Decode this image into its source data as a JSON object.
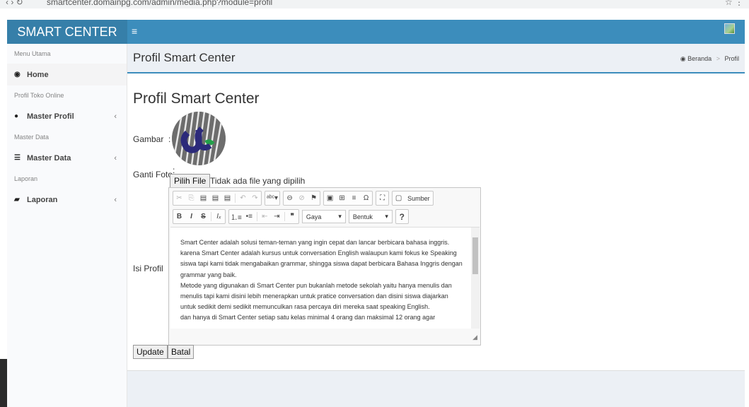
{
  "browser": {
    "nav": "‹ › ↻",
    "url": "smartcenter.domainpg.com/admin/media.php?module=profil",
    "right": "☆ ⋮"
  },
  "header": {
    "brand": "SMART CENTER",
    "menu_icon": "hamburger-icon"
  },
  "sidebar": {
    "sections": [
      {
        "header": "Menu Utama",
        "items": [
          {
            "label": "Home",
            "icon": "dashboard-icon"
          }
        ]
      },
      {
        "header": "Profil Toko Online",
        "items": [
          {
            "label": "Master Profil",
            "icon": "user-icon"
          }
        ]
      },
      {
        "header": "Master Data",
        "items": [
          {
            "label": "Master Data",
            "icon": "database-icon"
          }
        ]
      },
      {
        "header": "Laporan",
        "items": [
          {
            "label": "Laporan",
            "icon": "book-icon"
          }
        ]
      }
    ]
  },
  "content_header": {
    "title": "Profil Smart Center",
    "breadcrumb": [
      "Beranda",
      "Profil"
    ]
  },
  "form": {
    "heading": "Profil Smart Center",
    "gambar_label": "Gambar",
    "ganti_foto_label": "Ganti Foto",
    "file_button": "Pilih File",
    "file_status": "Tidak ada file yang dipilih",
    "isi_profil_label": "Isi Profil",
    "update_button": "Update",
    "batal_button": "Batal",
    "colon": ":"
  },
  "editor": {
    "style_combo": "Gaya",
    "format_combo": "Bentuk",
    "source_label": "Sumber",
    "help_label": "?",
    "content": [
      "Smart Center adalah solusi teman-teman yang ingin cepat dan lancar berbicara bahasa inggris. karena Smart Center adalah kursus untuk conversation English walaupun kami fokus ke Speaking siswa tapi kami tidak mengabaikan grammar, shingga siswa dapat berbicara Bahasa Inggris dengan grammar yang baik.",
      "Metode yang digunakan di Smart Center pun bukanlah metode sekolah yaitu hanya menulis dan menulis tapi kami disini lebih menerapkan untuk pratice conversation dan disini siswa diajarkan untuk sedikit demi sedikit memunculkan rasa percaya diri mereka saat speaking English.",
      "dan hanya di Smart Center setiap satu kelas minimal 4 orang dan maksimal 12 orang agar"
    ]
  },
  "colors": {
    "header_dark": "#367fa9",
    "header": "#3c8dbc",
    "content_bg": "#ecf0f5"
  }
}
